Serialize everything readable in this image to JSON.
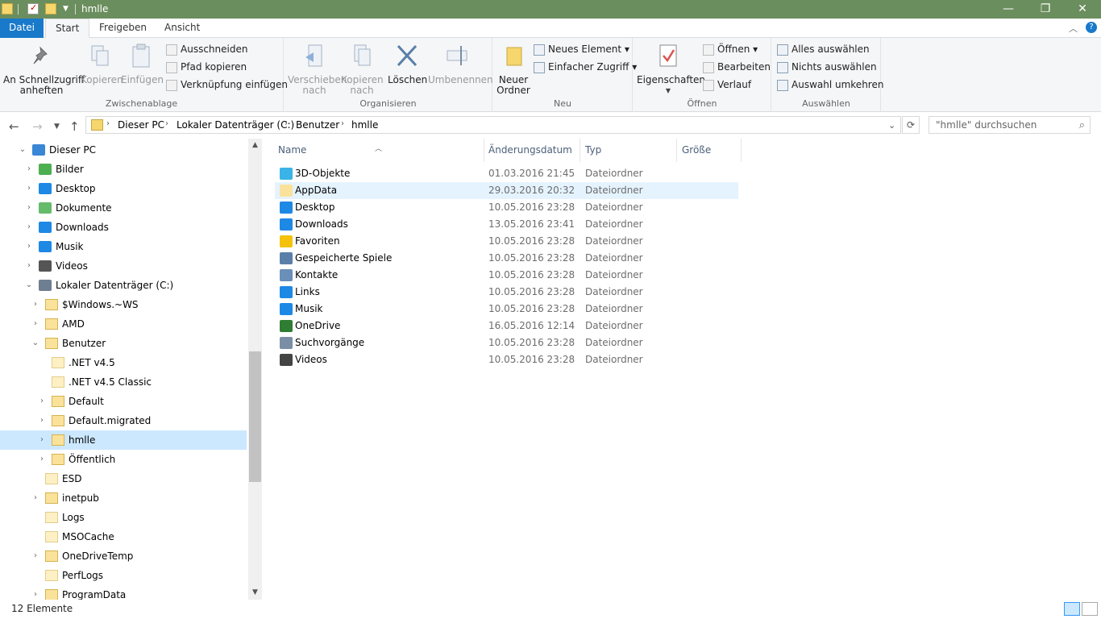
{
  "window": {
    "title": "hmlle"
  },
  "tabs": [
    {
      "label": "Datei"
    },
    {
      "label": "Start"
    },
    {
      "label": "Freigeben"
    },
    {
      "label": "Ansicht"
    }
  ],
  "ribbon": {
    "clipboard": {
      "label": "Zwischenablage",
      "pin": "An Schnellzugriff\nanheften",
      "copy": "Kopieren",
      "paste": "Einfügen",
      "cut": "Ausschneiden",
      "copy_path": "Pfad kopieren",
      "paste_link": "Verknüpfung einfügen"
    },
    "organize": {
      "label": "Organisieren",
      "move": "Verschieben\nnach",
      "copy_to": "Kopieren\nnach",
      "delete": "Löschen",
      "rename": "Umbenennen"
    },
    "new": {
      "label": "Neu",
      "new_folder": "Neuer\nOrdner",
      "new_item": "Neues Element",
      "easy_access": "Einfacher Zugriff"
    },
    "open": {
      "label": "Öffnen",
      "properties": "Eigenschaften",
      "open": "Öffnen",
      "edit": "Bearbeiten",
      "history": "Verlauf"
    },
    "select": {
      "label": "Auswählen",
      "select_all": "Alles auswählen",
      "select_none": "Nichts auswählen",
      "invert": "Auswahl umkehren"
    }
  },
  "address": {
    "crumbs": [
      "Dieser PC",
      "Lokaler Datenträger (C:)",
      "Benutzer",
      "hmlle"
    ],
    "search_placeholder": "\"hmlle\" durchsuchen"
  },
  "tree": [
    {
      "label": "Dieser PC",
      "level": 0,
      "expanded": true,
      "icon": "computer-icon"
    },
    {
      "label": "Bilder",
      "level": 1,
      "icon": "pictures-icon"
    },
    {
      "label": "Desktop",
      "level": 1,
      "icon": "desktop-icon"
    },
    {
      "label": "Dokumente",
      "level": 1,
      "icon": "documents-icon"
    },
    {
      "label": "Downloads",
      "level": 1,
      "icon": "downloads-icon"
    },
    {
      "label": "Musik",
      "level": 1,
      "icon": "music-icon"
    },
    {
      "label": "Videos",
      "level": 1,
      "icon": "videos-icon"
    },
    {
      "label": "Lokaler Datenträger (C:)",
      "level": 1,
      "expanded": true,
      "icon": "drive-icon"
    },
    {
      "label": "$Windows.~WS",
      "level": 2,
      "icon": "folder-icon"
    },
    {
      "label": "AMD",
      "level": 2,
      "icon": "folder-icon"
    },
    {
      "label": "Benutzer",
      "level": 2,
      "expanded": true,
      "icon": "folder-icon"
    },
    {
      "label": ".NET v4.5",
      "level": 3,
      "icon": "folder-icon"
    },
    {
      "label": ".NET v4.5 Classic",
      "level": 3,
      "icon": "folder-icon"
    },
    {
      "label": "Default",
      "level": 3,
      "icon": "folder-icon"
    },
    {
      "label": "Default.migrated",
      "level": 3,
      "icon": "folder-icon"
    },
    {
      "label": "hmlle",
      "level": 3,
      "selected": true,
      "icon": "folder-icon"
    },
    {
      "label": "Öffentlich",
      "level": 3,
      "icon": "folder-icon"
    },
    {
      "label": "ESD",
      "level": 2,
      "icon": "folder-icon"
    },
    {
      "label": "inetpub",
      "level": 2,
      "icon": "folder-icon"
    },
    {
      "label": "Logs",
      "level": 2,
      "icon": "folder-icon"
    },
    {
      "label": "MSOCache",
      "level": 2,
      "icon": "folder-icon"
    },
    {
      "label": "OneDriveTemp",
      "level": 2,
      "icon": "folder-icon"
    },
    {
      "label": "PerfLogs",
      "level": 2,
      "icon": "folder-icon"
    },
    {
      "label": "ProgramData",
      "level": 2,
      "icon": "folder-icon"
    }
  ],
  "columns": [
    "Name",
    "Änderungsdatum",
    "Typ",
    "Größe"
  ],
  "files": [
    {
      "name": "3D-Objekte",
      "date": "01.03.2016 21:45",
      "type": "Dateiordner"
    },
    {
      "name": "AppData",
      "date": "29.03.2016 20:32",
      "type": "Dateiordner"
    },
    {
      "name": "Desktop",
      "date": "10.05.2016 23:28",
      "type": "Dateiordner"
    },
    {
      "name": "Downloads",
      "date": "13.05.2016 23:41",
      "type": "Dateiordner"
    },
    {
      "name": "Favoriten",
      "date": "10.05.2016 23:28",
      "type": "Dateiordner"
    },
    {
      "name": "Gespeicherte Spiele",
      "date": "10.05.2016 23:28",
      "type": "Dateiordner"
    },
    {
      "name": "Kontakte",
      "date": "10.05.2016 23:28",
      "type": "Dateiordner"
    },
    {
      "name": "Links",
      "date": "10.05.2016 23:28",
      "type": "Dateiordner"
    },
    {
      "name": "Musik",
      "date": "10.05.2016 23:28",
      "type": "Dateiordner"
    },
    {
      "name": "OneDrive",
      "date": "16.05.2016 12:14",
      "type": "Dateiordner"
    },
    {
      "name": "Suchvorgänge",
      "date": "10.05.2016 23:28",
      "type": "Dateiordner"
    },
    {
      "name": "Videos",
      "date": "10.05.2016 23:28",
      "type": "Dateiordner"
    }
  ],
  "status": {
    "count": "12 Elemente"
  }
}
